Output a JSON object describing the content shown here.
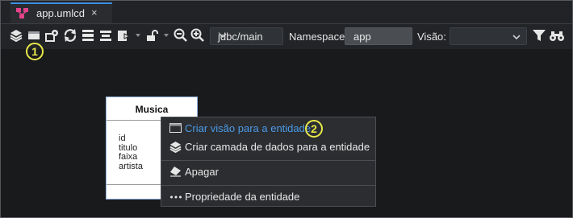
{
  "tab": {
    "title": "app.umlcd",
    "close": "×"
  },
  "toolbar": {
    "datasource": "jdbc/main",
    "namespace_label": "Namespace",
    "namespace_value": "app",
    "view_label": "Visão:",
    "view_value": "",
    "icons": [
      "layers-icon",
      "view-icon",
      "datalayer-settings-icon",
      "refresh-icon",
      "align-top-icon",
      "align-center-icon",
      "export-icon",
      "unlock-icon",
      "zoom-out-icon",
      "zoom-in-icon",
      "filter-icon",
      "binoculars-icon"
    ]
  },
  "markers": {
    "one": "1",
    "two": "2"
  },
  "entity": {
    "name": "Musica",
    "fields": [
      "id",
      "titulo",
      "faixa",
      "artista"
    ]
  },
  "context_menu": {
    "items": [
      {
        "label": "Criar visão para a entidade",
        "icon": "view-icon"
      },
      {
        "label": "Criar camada de dados para a entidade",
        "icon": "layers-icon"
      },
      {
        "label": "Apagar",
        "icon": "eraser-icon"
      },
      {
        "label": "Propriedade da entidade",
        "icon": "more-icon"
      }
    ]
  },
  "colors": {
    "accent": "#3b8fe4",
    "menu_highlight_text": "#4c9ae8",
    "marker": "#e8e84a",
    "background": "#191a1c"
  }
}
